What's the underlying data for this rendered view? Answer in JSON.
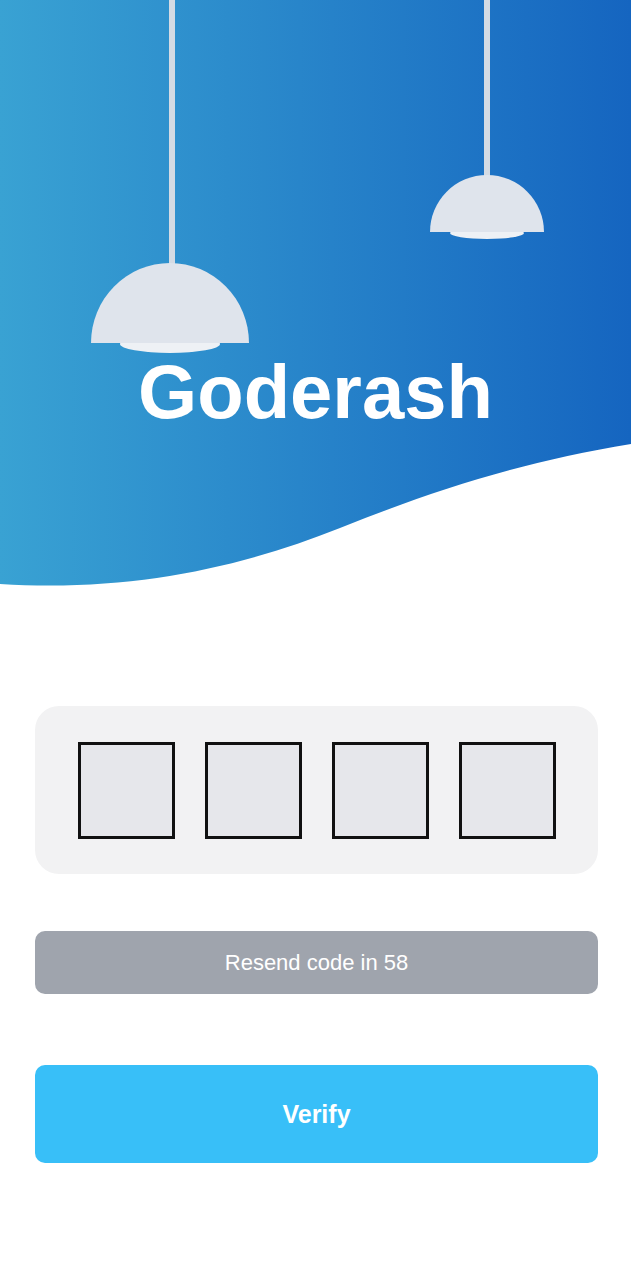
{
  "app": {
    "title": "Goderash"
  },
  "code": {
    "digits": [
      {
        "value": ""
      },
      {
        "value": ""
      },
      {
        "value": ""
      },
      {
        "value": ""
      }
    ]
  },
  "resend": {
    "label": "Resend code in 58",
    "disabled": true
  },
  "verify": {
    "label": "Verify",
    "disabled": false
  }
}
